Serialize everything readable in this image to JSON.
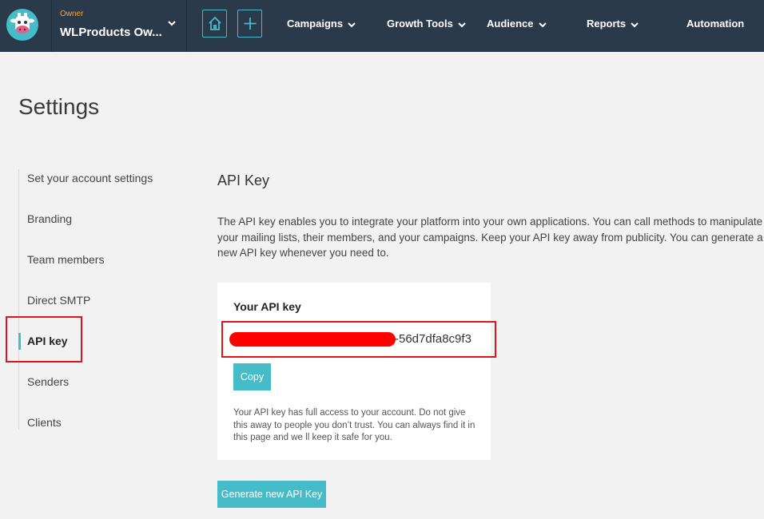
{
  "nav": {
    "role": "Owner",
    "account_name": "WLProducts Ow...",
    "items": [
      {
        "label": "Campaigns"
      },
      {
        "label": "Growth Tools"
      },
      {
        "label": "Audience"
      },
      {
        "label": "Reports"
      },
      {
        "label": "Automation"
      }
    ],
    "accent_color": "#46bcc9",
    "bg_color": "#2b3a4b"
  },
  "page": {
    "title": "Settings"
  },
  "sidebar": {
    "items": [
      {
        "label": "Set your account settings"
      },
      {
        "label": "Branding"
      },
      {
        "label": "Team members"
      },
      {
        "label": "Direct SMTP"
      },
      {
        "label": "API key",
        "active": true
      },
      {
        "label": "Senders"
      },
      {
        "label": "Clients"
      }
    ]
  },
  "api": {
    "section_title": "API Key",
    "description": "The API key enables you to integrate your platform into your own applications. You can call methods to manipulate your mailing lists, their members, and your campaigns. Keep your API key away from publicity. You can generate a new API key whenever you need to.",
    "card_title": "Your API key",
    "key_suffix": "-56d7dfa8c9f3",
    "copy_label": "Copy",
    "note": "Your API key has full access to your account. Do not give this away to people you don’t trust. You can always find it in this page and we ll keep it safe for you.",
    "generate_label": "Generate new API Key",
    "highlight_color": "#e0141b"
  }
}
